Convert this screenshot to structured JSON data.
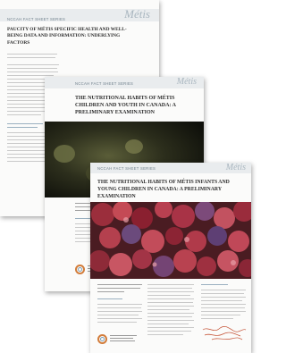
{
  "documents": [
    {
      "header_tag": "NCCAH FACT SHEET SERIES",
      "brand": "Métis",
      "title": "PAUCITY OF MÉTIS SPECIFIC HEALTH AND WELL-BEING DATA AND INFORMATION: UNDERLYING FACTORS"
    },
    {
      "header_tag": "NCCAH FACT SHEET SERIES",
      "brand": "Métis",
      "title": "THE NUTRITIONAL HABITS OF MÉTIS CHILDREN AND YOUTH IN CANADA: A PRELIMINARY EXAMINATION"
    },
    {
      "header_tag": "NCCAH FACT SHEET SERIES",
      "brand": "Métis",
      "title": "THE NUTRITIONAL HABITS OF MÉTIS INFANTS AND YOUNG CHILDREN IN CANADA: A PRELIMINARY EXAMINATION"
    }
  ],
  "colors": {
    "band": "#e9ecee",
    "accent": "#6d7e8a",
    "berries": "#9b2e3c",
    "signature": "#c44f32"
  }
}
